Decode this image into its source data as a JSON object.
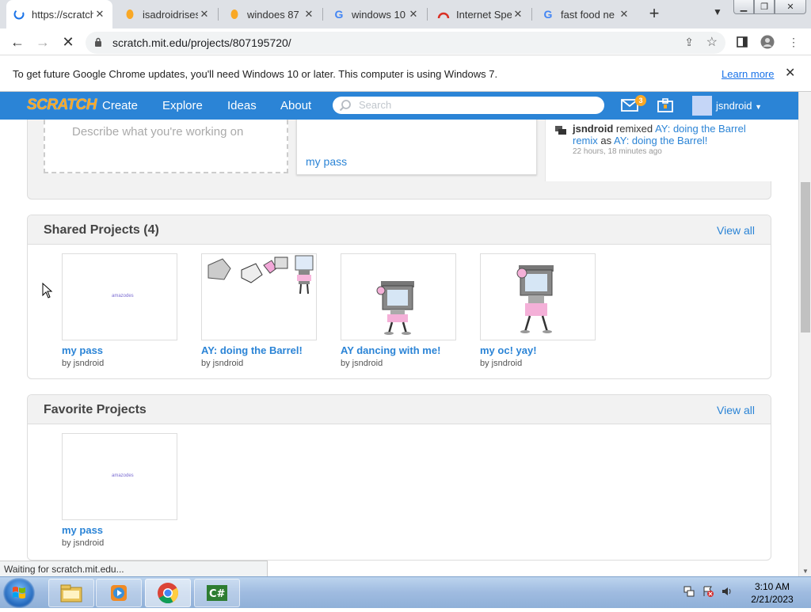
{
  "browser": {
    "tabs": [
      {
        "title": "https://scratch",
        "active": true,
        "icon": "loading-spinner-icon"
      },
      {
        "title": "isadroidrises",
        "active": false,
        "icon": "scratch-favicon-icon"
      },
      {
        "title": "windoes 87",
        "active": false,
        "icon": "scratch-favicon-icon"
      },
      {
        "title": "windows 10",
        "active": false,
        "icon": "google-favicon-icon"
      },
      {
        "title": "Internet Spe",
        "active": false,
        "icon": "speedtest-favicon-icon"
      },
      {
        "title": "fast food ne",
        "active": false,
        "icon": "google-favicon-icon"
      }
    ],
    "new_tab_label": "+",
    "url": "scratch.mit.edu/projects/807195720/"
  },
  "infobar": {
    "message": "To get future Google Chrome updates, you'll need Windows 10 or later. This computer is using Windows 7.",
    "link": "Learn more"
  },
  "scratch_nav": {
    "logo": "SCRATCH",
    "links": [
      "Create",
      "Explore",
      "Ideas",
      "About"
    ],
    "search_placeholder": "Search",
    "message_count": "3",
    "username": "jsndroid"
  },
  "top_section": {
    "description_placeholder": "Describe what you're working on",
    "featured_title": "my pass",
    "activity": {
      "user": "jsndroid",
      "action": "remixed",
      "original": "AY: doing the Barrel remix",
      "connector": "as",
      "result": "AY: doing the Barrel!",
      "time": "22 hours, 18 minutes ago"
    }
  },
  "shared_projects": {
    "heading": "Shared Projects (4)",
    "view_all": "View all",
    "items": [
      {
        "title": "my pass",
        "by": "by jsndroid",
        "thumb_text": "amazodes"
      },
      {
        "title": "AY: doing the Barrel!",
        "by": "by jsndroid",
        "thumb_text": ""
      },
      {
        "title": "AY dancing with me!",
        "by": "by jsndroid",
        "thumb_text": ""
      },
      {
        "title": "my oc! yay!",
        "by": "by jsndroid",
        "thumb_text": ""
      }
    ]
  },
  "favorite_projects": {
    "heading": "Favorite Projects",
    "view_all": "View all",
    "items": [
      {
        "title": "my pass",
        "by": "by jsndroid",
        "thumb_text": "amazodes"
      }
    ]
  },
  "status_text": "Waiting for scratch.mit.edu...",
  "taskbar": {
    "time": "3:10 AM",
    "date": "2/21/2023",
    "apps": [
      "file-explorer-icon",
      "media-player-icon",
      "chrome-icon",
      "csharp-icon"
    ]
  },
  "colors": {
    "scratch_blue": "#2b84d6",
    "link_blue": "#2b84d6",
    "logo_orange": "#f9a825"
  }
}
